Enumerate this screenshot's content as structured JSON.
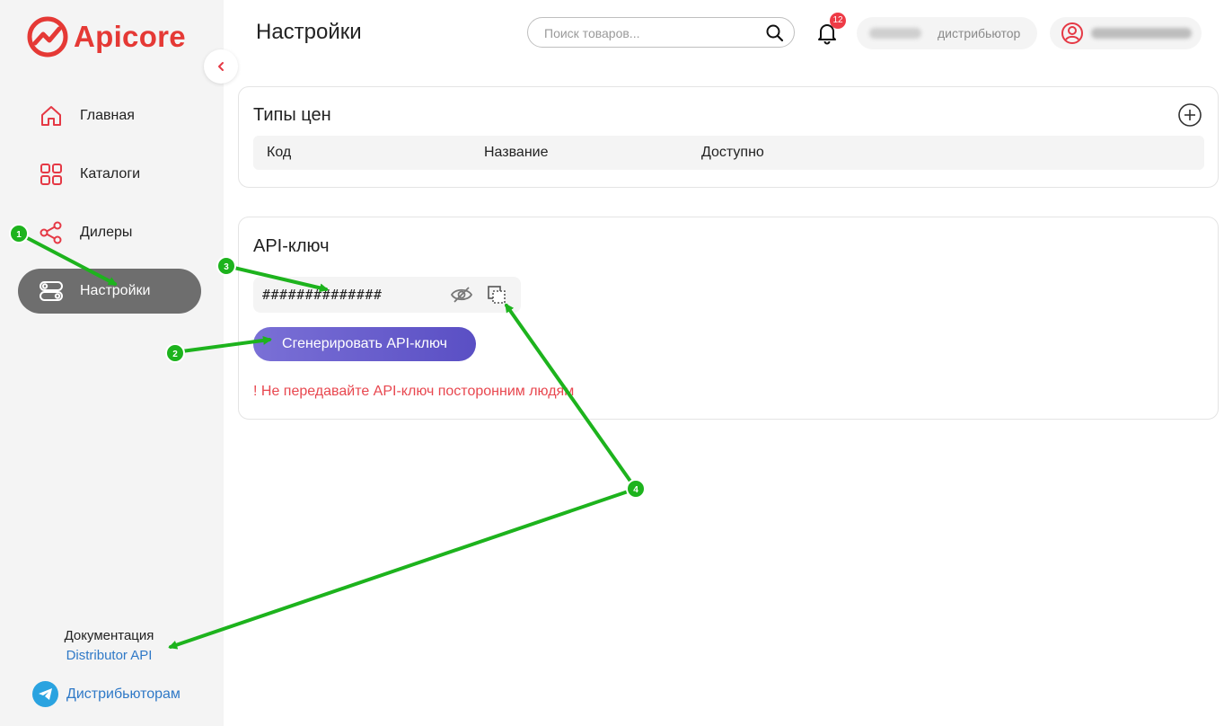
{
  "brand": {
    "name": "Apicore",
    "accent": "#e53935"
  },
  "sidebar": {
    "items": [
      {
        "label": "Главная",
        "icon": "home-icon",
        "active": false
      },
      {
        "label": "Каталоги",
        "icon": "grid-icon",
        "active": false
      },
      {
        "label": "Дилеры",
        "icon": "share-icon",
        "active": false
      },
      {
        "label": "Настройки",
        "icon": "toggles-icon",
        "active": true
      }
    ],
    "docs_title": "Документация",
    "docs_link": "Distributor API",
    "telegram_label": "Дистрибьюторам"
  },
  "header": {
    "title": "Настройки",
    "search_placeholder": "Поиск товаров...",
    "notifications_count": "12",
    "role": "дистрибьютор"
  },
  "price_types": {
    "title": "Типы цен",
    "columns": [
      "Код",
      "Название",
      "Доступно"
    ]
  },
  "api_key": {
    "title": "API-ключ",
    "masked_value": "##############",
    "generate_label": "Сгенерировать API-ключ",
    "warning": "! Не передавайте API-ключ посторонним людям"
  },
  "annotations": [
    "1",
    "2",
    "3",
    "4"
  ],
  "colors": {
    "active_nav": "#6e6e6e",
    "button": "#5a4fc4",
    "warning": "#e8474f",
    "link": "#2f79c7",
    "annotation": "#1db31d"
  }
}
